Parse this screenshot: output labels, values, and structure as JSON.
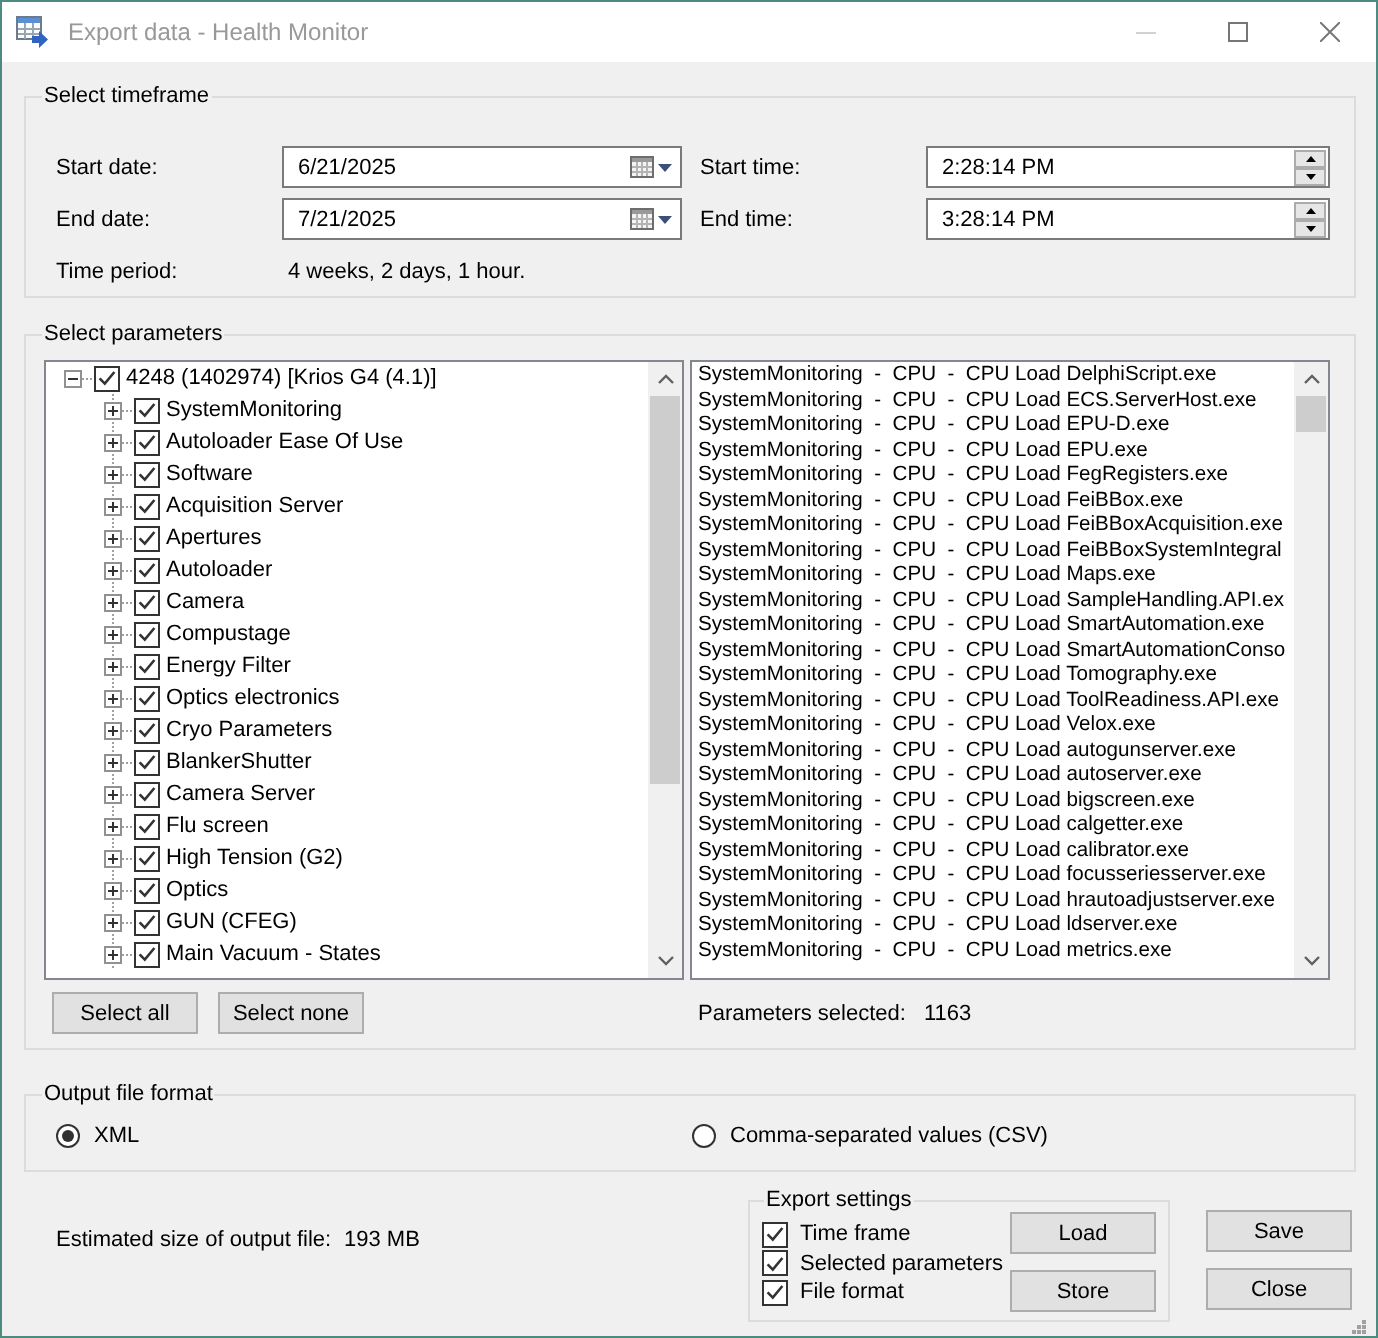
{
  "window": {
    "title": "Export data - Health Monitor",
    "active": false,
    "controls": [
      {
        "kind": "minimize",
        "disabled": true
      },
      {
        "kind": "maximize",
        "disabled": false
      },
      {
        "kind": "close",
        "disabled": false
      }
    ]
  },
  "timeframe": {
    "legend": "Select timeframe",
    "fields": [
      {
        "kind": "date",
        "label": "Start date:",
        "value": "6/21/2025"
      },
      {
        "kind": "time",
        "label": "Start time:",
        "value": "2:28:14 PM"
      },
      {
        "kind": "date",
        "label": "End date:",
        "value": "7/21/2025"
      },
      {
        "kind": "time",
        "label": "End time:",
        "value": "3:28:14 PM"
      }
    ],
    "period": {
      "label": "Time period:",
      "value": "4 weeks, 2 days, 1 hour."
    }
  },
  "parameters": {
    "legend": "Select parameters",
    "tree": {
      "label": "4248 (1402974) [Krios G4 (4.1)]",
      "expanded": true,
      "checked": true,
      "children": [
        {
          "label": "SystemMonitoring",
          "expanded": false,
          "checked": true
        },
        {
          "label": "Autoloader Ease Of Use",
          "expanded": false,
          "checked": true
        },
        {
          "label": "Software",
          "expanded": false,
          "checked": true
        },
        {
          "label": "Acquisition Server",
          "expanded": false,
          "checked": true
        },
        {
          "label": "Apertures",
          "expanded": false,
          "checked": true
        },
        {
          "label": "Autoloader",
          "expanded": false,
          "checked": true
        },
        {
          "label": "Camera",
          "expanded": false,
          "checked": true
        },
        {
          "label": "Compustage",
          "expanded": false,
          "checked": true
        },
        {
          "label": "Energy Filter",
          "expanded": false,
          "checked": true
        },
        {
          "label": "Optics electronics",
          "expanded": false,
          "checked": true
        },
        {
          "label": "Cryo Parameters",
          "expanded": false,
          "checked": true
        },
        {
          "label": "BlankerShutter",
          "expanded": false,
          "checked": true
        },
        {
          "label": "Camera Server",
          "expanded": false,
          "checked": true
        },
        {
          "label": "Flu screen",
          "expanded": false,
          "checked": true
        },
        {
          "label": "High Tension (G2)",
          "expanded": false,
          "checked": true
        },
        {
          "label": "Optics",
          "expanded": false,
          "checked": true
        },
        {
          "label": "GUN (CFEG)",
          "expanded": false,
          "checked": true
        },
        {
          "label": "Main Vacuum - States",
          "expanded": false,
          "checked": true
        }
      ]
    },
    "selected_list": [
      "SystemMonitoring  -  CPU  -  CPU Load DelphiScript.exe",
      "SystemMonitoring  -  CPU  -  CPU Load ECS.ServerHost.exe",
      "SystemMonitoring  -  CPU  -  CPU Load EPU-D.exe",
      "SystemMonitoring  -  CPU  -  CPU Load EPU.exe",
      "SystemMonitoring  -  CPU  -  CPU Load FegRegisters.exe",
      "SystemMonitoring  -  CPU  -  CPU Load FeiBBox.exe",
      "SystemMonitoring  -  CPU  -  CPU Load FeiBBoxAcquisition.exe",
      "SystemMonitoring  -  CPU  -  CPU Load FeiBBoxSystemIntegral",
      "SystemMonitoring  -  CPU  -  CPU Load Maps.exe",
      "SystemMonitoring  -  CPU  -  CPU Load SampleHandling.API.ex",
      "SystemMonitoring  -  CPU  -  CPU Load SmartAutomation.exe",
      "SystemMonitoring  -  CPU  -  CPU Load SmartAutomationConso",
      "SystemMonitoring  -  CPU  -  CPU Load Tomography.exe",
      "SystemMonitoring  -  CPU  -  CPU Load ToolReadiness.API.exe",
      "SystemMonitoring  -  CPU  -  CPU Load Velox.exe",
      "SystemMonitoring  -  CPU  -  CPU Load autogunserver.exe",
      "SystemMonitoring  -  CPU  -  CPU Load autoserver.exe",
      "SystemMonitoring  -  CPU  -  CPU Load bigscreen.exe",
      "SystemMonitoring  -  CPU  -  CPU Load calgetter.exe",
      "SystemMonitoring  -  CPU  -  CPU Load calibrator.exe",
      "SystemMonitoring  -  CPU  -  CPU Load focusseriesserver.exe",
      "SystemMonitoring  -  CPU  -  CPU Load hrautoadjustserver.exe",
      "SystemMonitoring  -  CPU  -  CPU Load ldserver.exe",
      "SystemMonitoring  -  CPU  -  CPU Load metrics.exe"
    ],
    "buttons": [
      "Select all",
      "Select none"
    ],
    "count": {
      "label": "Parameters selected:",
      "value": "1163"
    }
  },
  "output_format": {
    "legend": "Output file format",
    "options": [
      {
        "label": "XML",
        "selected": true
      },
      {
        "label": "Comma-separated values (CSV)",
        "selected": false
      }
    ]
  },
  "estimate": {
    "label": "Estimated size of output file:",
    "value": "193 MB"
  },
  "export_settings": {
    "legend": "Export settings",
    "options": [
      {
        "label": "Time frame",
        "checked": true
      },
      {
        "label": "Selected parameters",
        "checked": true
      },
      {
        "label": "File format",
        "checked": true
      }
    ],
    "buttons": [
      "Load",
      "Store"
    ]
  },
  "buttons": [
    "Save",
    "Close"
  ]
}
